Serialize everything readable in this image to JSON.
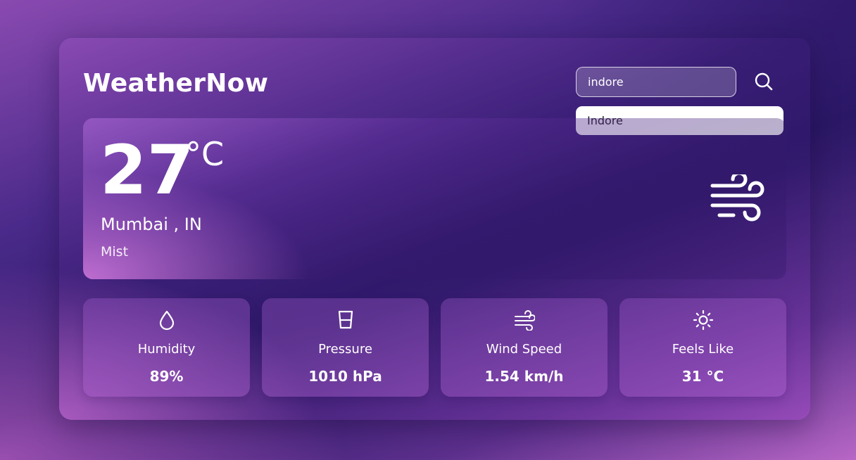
{
  "app": {
    "title": "WeatherNow"
  },
  "search": {
    "value": "indore",
    "suggestions": [
      "Indore"
    ]
  },
  "current": {
    "temperature": "27",
    "unit": "°C",
    "location": "Mumbai , IN",
    "condition": "Mist",
    "icon": "wind-icon"
  },
  "stats": [
    {
      "icon": "droplet-icon",
      "label": "Humidity",
      "value": "89%"
    },
    {
      "icon": "cup-icon",
      "label": "Pressure",
      "value": "1010 hPa"
    },
    {
      "icon": "wind-icon",
      "label": "Wind Speed",
      "value": "1.54 km/h"
    },
    {
      "icon": "sun-icon",
      "label": "Feels Like",
      "value": "31 °C"
    }
  ],
  "colors": {
    "accent": "#ffffff",
    "background_dark": "#2b1866",
    "background_glow": "#e87ce6"
  }
}
